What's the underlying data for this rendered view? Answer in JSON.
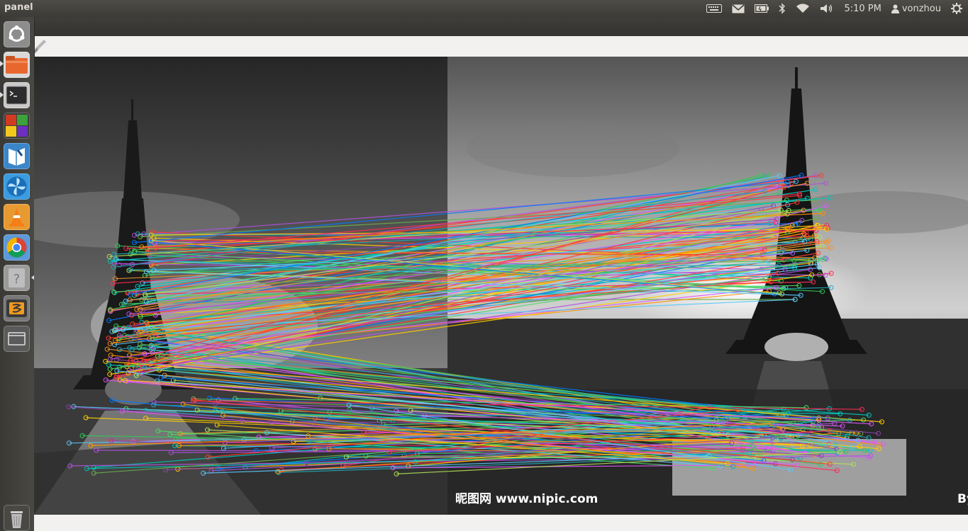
{
  "panel": {
    "title": "panel",
    "clock": "5:10 PM",
    "user": "vonzhou"
  },
  "tray_icons": [
    "keyboard-icon",
    "mail-icon",
    "battery-icon",
    "bluetooth-icon",
    "wifi-icon",
    "volume-icon",
    "user-icon",
    "gear-icon"
  ],
  "launcher": {
    "items": [
      {
        "name": "dash-home",
        "icon": "ubuntu-logo-icon",
        "color": "#9a9a9a"
      },
      {
        "name": "files",
        "icon": "folder-icon",
        "color": "#e8672f"
      },
      {
        "name": "terminal",
        "icon": "terminal-icon",
        "color": "#2c2c2c"
      },
      {
        "name": "app-grid",
        "icon": "colored-blocks-icon",
        "color": "#d23a22"
      },
      {
        "name": "reader",
        "icon": "book-icon",
        "color": "#3b86c9"
      },
      {
        "name": "shotwell",
        "icon": "pinwheel-icon",
        "color": "#3b9be0"
      },
      {
        "name": "vlc",
        "icon": "traffic-cone-icon",
        "color": "#e8821e"
      },
      {
        "name": "chrome",
        "icon": "chrome-icon",
        "color": "#4a90d9"
      },
      {
        "name": "unknown-app",
        "icon": "question-mark-icon",
        "color": "#888888"
      },
      {
        "name": "sublime-text",
        "icon": "sublime-icon",
        "color": "#5a5a5a"
      },
      {
        "name": "workspace-switcher",
        "icon": "window-icon",
        "color": "#6b6b6b"
      }
    ],
    "trash": {
      "icon": "trash-icon"
    }
  },
  "image": {
    "watermark": "昵图网 www.nipic.com",
    "corner_text": "By",
    "match_line_count": 260
  }
}
